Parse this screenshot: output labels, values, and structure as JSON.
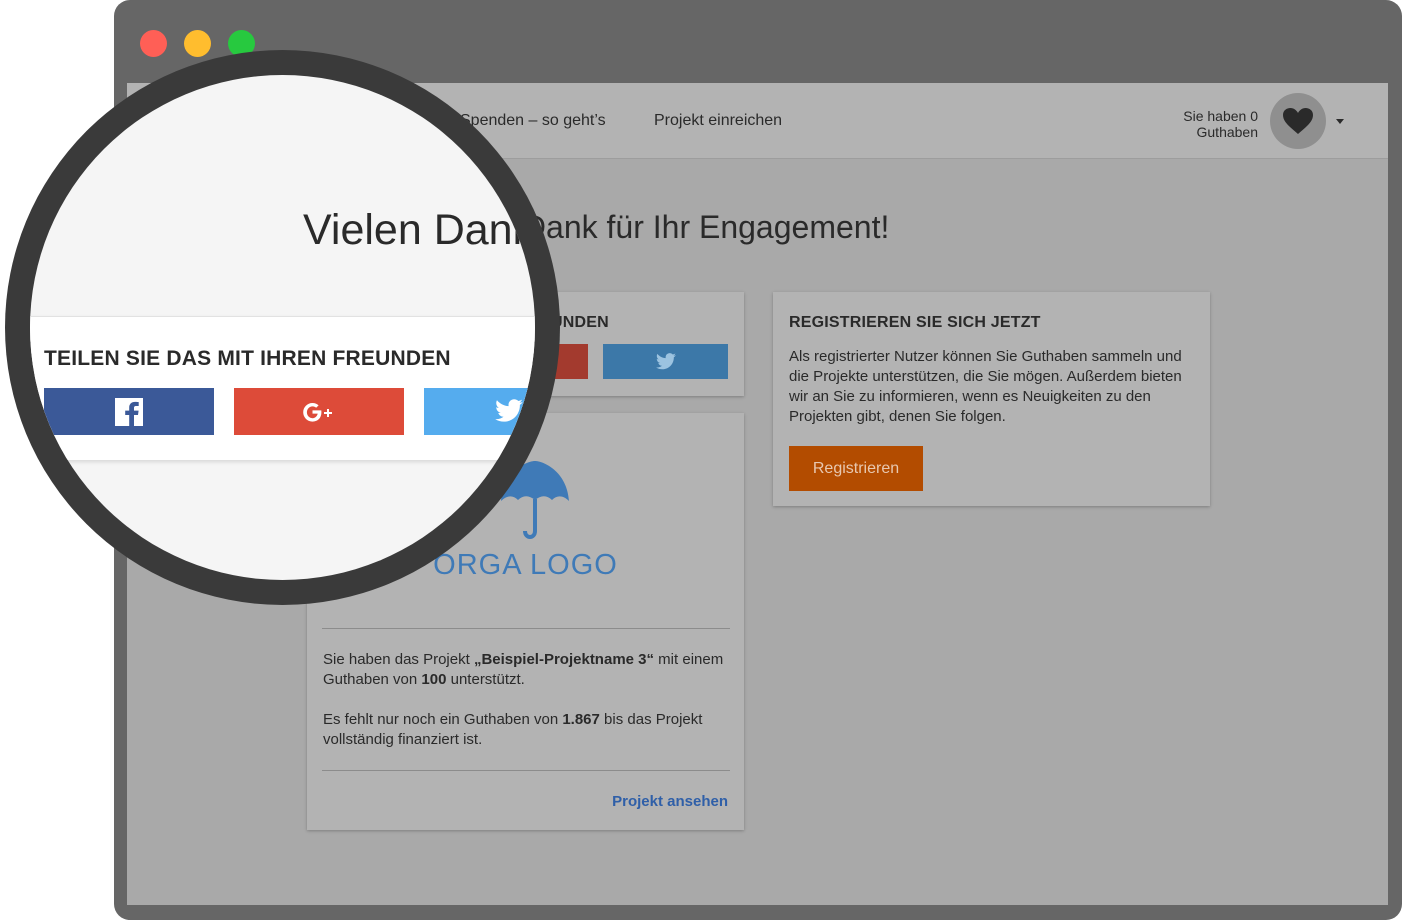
{
  "nav": {
    "link_1": "Spenden – so geht’s",
    "link_2": "Projekt einreichen",
    "credits_line_1": "Sie haben 0",
    "credits_line_2": "Guthaben"
  },
  "headline": "Vielen Dank für Ihr Engagement!",
  "share_card": {
    "title_partial": "UNDEN"
  },
  "register_card": {
    "title": "REGISTRIEREN SIE SICH JETZT",
    "text": "Als registrierter Nutzer können Sie Guthaben sammeln und die Projekte unterstützen, die Sie mögen. Außerdem bieten wir an Sie zu informieren, wenn es Neuigkeiten zu den Projekten gibt, denen Sie folgen.",
    "button": "Registrieren"
  },
  "project_card": {
    "logo_text": "ORGA LOGO",
    "text_1_prefix": "Sie haben das Projekt ",
    "project_name": "„Beispiel-Projektname 3“",
    "text_1_middle": " mit einem Guthaben von ",
    "amount": "100",
    "text_1_suffix": " unterstützt.",
    "text_2_prefix": "Es fehlt nur noch ein Guthaben von ",
    "missing": "1.867",
    "text_2_suffix": " bis das Projekt vollständig finanziert ist.",
    "link": "Projekt ansehen"
  },
  "magnifier": {
    "title_partial": "Vielen Dank",
    "share_title": "TEILEN SIE DAS MIT IHREN FREUNDEN"
  },
  "colors": {
    "facebook": "#3b5998",
    "google_plus": "#dd4b39",
    "twitter": "#55acee",
    "register_button": "#b34c00",
    "link": "#2f5fa8"
  },
  "icons": {
    "window_buttons": [
      "close",
      "minimize",
      "maximize"
    ],
    "avatar": "heart-icon",
    "share": [
      "facebook-icon",
      "google-plus-icon",
      "twitter-icon"
    ],
    "logo": "umbrella-icon"
  }
}
